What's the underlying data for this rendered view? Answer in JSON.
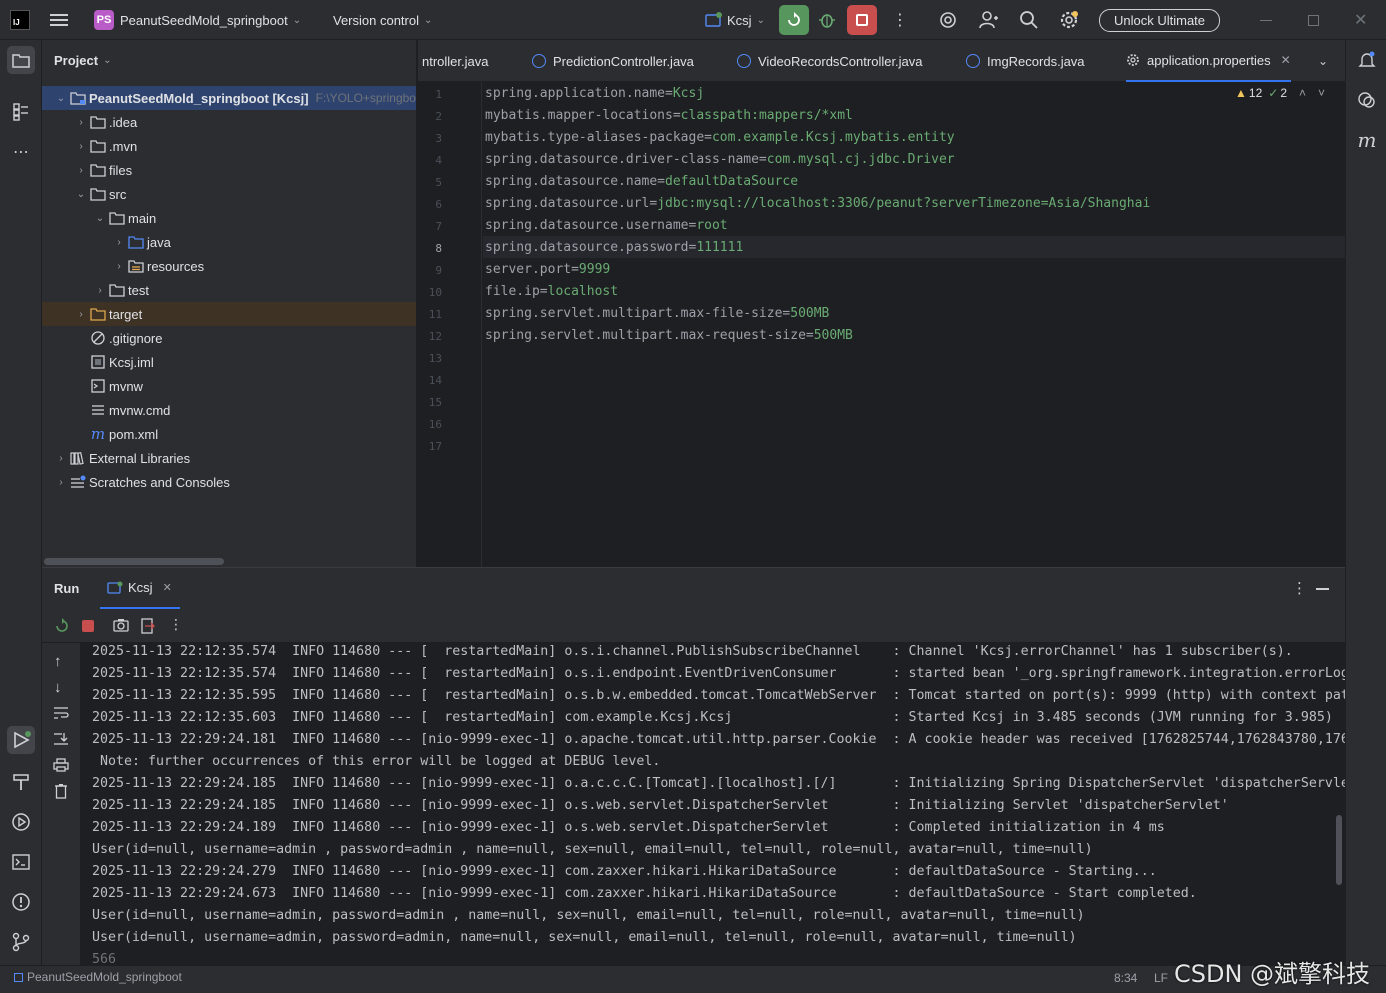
{
  "titlebar": {
    "project_badge": "PS",
    "project_name": "PeanutSeedMold_springboot",
    "vcs": "Version control",
    "run_config": "Kcsj",
    "unlock": "Unlock Ultimate"
  },
  "project": {
    "title": "Project",
    "root_name": "PeanutSeedMold_springboot [Kcsj]",
    "root_path": "F:\\YOLO+springbo",
    "items": [
      {
        "label": ".idea"
      },
      {
        "label": ".mvn"
      },
      {
        "label": "files"
      },
      {
        "label": "src"
      },
      {
        "label": "main"
      },
      {
        "label": "java"
      },
      {
        "label": "resources"
      },
      {
        "label": "test"
      },
      {
        "label": "target"
      },
      {
        "label": ".gitignore"
      },
      {
        "label": "Kcsj.iml"
      },
      {
        "label": "mvnw"
      },
      {
        "label": "mvnw.cmd"
      },
      {
        "label": "pom.xml"
      },
      {
        "label": "External Libraries"
      },
      {
        "label": "Scratches and Consoles"
      }
    ]
  },
  "tabs": [
    {
      "label": "ntroller.java"
    },
    {
      "label": "PredictionController.java"
    },
    {
      "label": "VideoRecordsController.java"
    },
    {
      "label": "ImgRecords.java"
    },
    {
      "label": "application.properties"
    }
  ],
  "inspections": {
    "warnings": "12",
    "checks": "2"
  },
  "editor": {
    "line_numbers": [
      "1",
      "2",
      "3",
      "4",
      "5",
      "6",
      "7",
      "8",
      "9",
      "10",
      "11",
      "12",
      "13",
      "14",
      "15",
      "16",
      "17"
    ],
    "lines": [
      {
        "key": "spring.application.name=",
        "value": "Kcsj"
      },
      {
        "key": "mybatis.mapper-locations=",
        "value": "classpath:mappers/*xml"
      },
      {
        "key": "mybatis.type-aliases-package=",
        "value": "com.example.Kcsj.mybatis.entity"
      },
      {
        "key": "spring.datasource.driver-class-name=",
        "value": "com.mysql.cj.jdbc.Driver"
      },
      {
        "key": "spring.datasource.name=",
        "value": "defaultDataSource"
      },
      {
        "key": "spring.datasource.url=",
        "value": "jdbc:mysql://localhost:3306/peanut?serverTimezone=Asia/Shanghai"
      },
      {
        "key": "spring.datasource.username=",
        "value": "root"
      },
      {
        "key": "spring.datasource.password=",
        "value": "111111"
      },
      {
        "key": "server.port=",
        "value": "9999"
      },
      {
        "key": "file.ip=",
        "value": "localhost"
      },
      {
        "key": "spring.servlet.multipart.max-file-size=",
        "value": "500MB"
      },
      {
        "key": "spring.servlet.multipart.max-request-size=",
        "value": "500MB"
      }
    ]
  },
  "run": {
    "title": "Run",
    "tab": "Kcsj",
    "output": [
      "2025-11-13 22:12:35.574  INFO 114680 --- [  restartedMain] o.s.i.channel.PublishSubscribeChannel    : Channel 'Kcsj.errorChannel' has 1 subscriber(s).",
      "2025-11-13 22:12:35.574  INFO 114680 --- [  restartedMain] o.s.i.endpoint.EventDrivenConsumer       : started bean '_org.springframework.integration.errorLogger'",
      "2025-11-13 22:12:35.595  INFO 114680 --- [  restartedMain] o.s.b.w.embedded.tomcat.TomcatWebServer  : Tomcat started on port(s): 9999 (http) with context path",
      "2025-11-13 22:12:35.603  INFO 114680 --- [  restartedMain] com.example.Kcsj.Kcsj                    : Started Kcsj in 3.485 seconds (JVM running for 3.985)",
      "2025-11-13 22:29:24.181  INFO 114680 --- [nio-9999-exec-1] o.apache.tomcat.util.http.parser.Cookie  : A cookie header was received [1762825744,1762843780,176",
      " Note: further occurrences of this error will be logged at DEBUG level.",
      "2025-11-13 22:29:24.185  INFO 114680 --- [nio-9999-exec-1] o.a.c.c.C.[Tomcat].[localhost].[/]       : Initializing Spring DispatcherServlet 'dispatcherServlet'",
      "2025-11-13 22:29:24.185  INFO 114680 --- [nio-9999-exec-1] o.s.web.servlet.DispatcherServlet        : Initializing Servlet 'dispatcherServlet'",
      "2025-11-13 22:29:24.189  INFO 114680 --- [nio-9999-exec-1] o.s.web.servlet.DispatcherServlet        : Completed initialization in 4 ms",
      "User(id=null, username=admin , password=admin , name=null, sex=null, email=null, tel=null, role=null, avatar=null, time=null)",
      "2025-11-13 22:29:24.279  INFO 114680 --- [nio-9999-exec-1] com.zaxxer.hikari.HikariDataSource       : defaultDataSource - Starting...",
      "2025-11-13 22:29:24.673  INFO 114680 --- [nio-9999-exec-1] com.zaxxer.hikari.HikariDataSource       : defaultDataSource - Start completed.",
      "User(id=null, username=admin, password=admin , name=null, sex=null, email=null, tel=null, role=null, avatar=null, time=null)",
      "User(id=null, username=admin, password=admin, name=null, sex=null, email=null, tel=null, role=null, avatar=null, time=null)",
      "566"
    ]
  },
  "status": {
    "breadcrumb": "PeanutSeedMold_springboot",
    "position": "8:34",
    "line_sep": "LF",
    "watermark": "CSDN @斌擎科技"
  },
  "colors": {
    "accent": "#3574f0",
    "run_green": "#57965c",
    "stop_red": "#c94f4f",
    "value_green": "#6aab73",
    "key_gray": "#9da0a8"
  }
}
